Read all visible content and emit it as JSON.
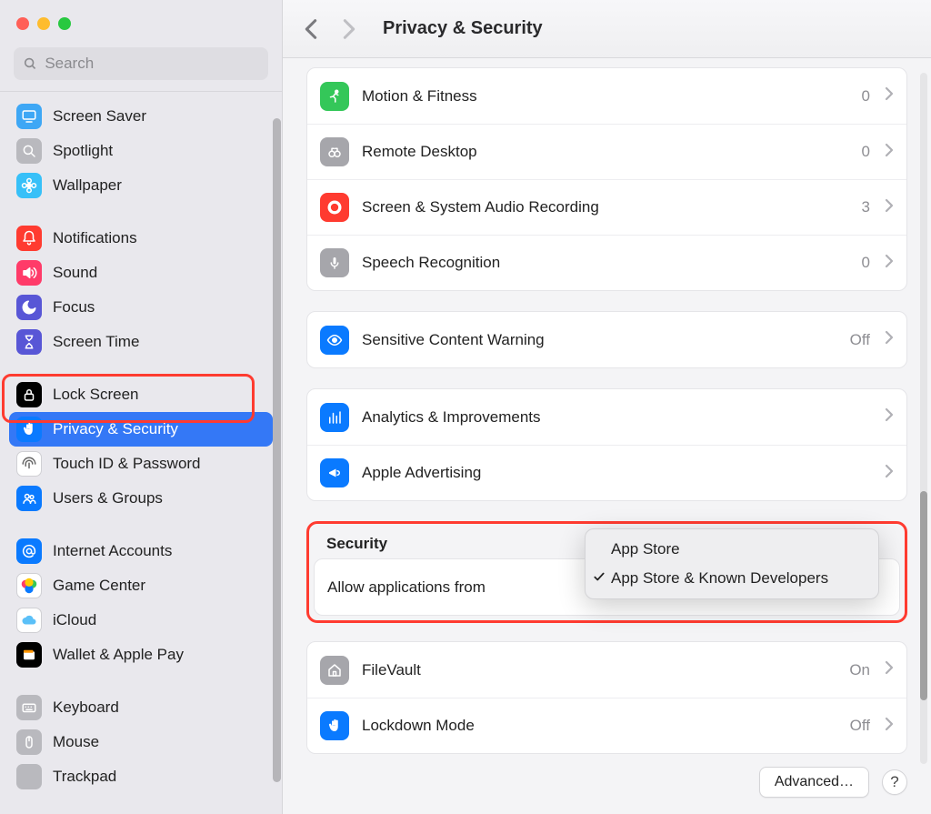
{
  "header": {
    "title": "Privacy & Security"
  },
  "search": {
    "placeholder": "Search"
  },
  "sidebar": {
    "groups": [
      {
        "items": [
          {
            "name": "screen-saver",
            "label": "Screen Saver",
            "icon_bg": "#3ea7f5",
            "icon": "monitor"
          },
          {
            "name": "spotlight",
            "label": "Spotlight",
            "icon_bg": "#b9b9be",
            "icon": "search"
          },
          {
            "name": "wallpaper",
            "label": "Wallpaper",
            "icon_bg": "#37c0f8",
            "icon": "flower"
          }
        ]
      },
      {
        "items": [
          {
            "name": "notifications",
            "label": "Notifications",
            "icon_bg": "#ff3b30",
            "icon": "bell"
          },
          {
            "name": "sound",
            "label": "Sound",
            "icon_bg": "#ff3b69",
            "icon": "speaker"
          },
          {
            "name": "focus",
            "label": "Focus",
            "icon_bg": "#5856d6",
            "icon": "moon"
          },
          {
            "name": "screen-time",
            "label": "Screen Time",
            "icon_bg": "#5856d6",
            "icon": "hourglass"
          }
        ]
      },
      {
        "items": [
          {
            "name": "lock-screen",
            "label": "Lock Screen",
            "icon_bg": "#000000",
            "icon": "lock"
          },
          {
            "name": "privacy-security",
            "label": "Privacy & Security",
            "icon_bg": "#0a7aff",
            "icon": "hand",
            "selected": true
          },
          {
            "name": "touch-id",
            "label": "Touch ID & Password",
            "icon_bg": "#ffffff",
            "icon": "fingerprint"
          },
          {
            "name": "users-groups",
            "label": "Users & Groups",
            "icon_bg": "#0a7aff",
            "icon": "users"
          }
        ]
      },
      {
        "items": [
          {
            "name": "internet-accounts",
            "label": "Internet Accounts",
            "icon_bg": "#0a7aff",
            "icon": "at"
          },
          {
            "name": "game-center",
            "label": "Game Center",
            "icon_bg": "#ffffff",
            "icon": "gamecenter"
          },
          {
            "name": "icloud",
            "label": "iCloud",
            "icon_bg": "#ffffff",
            "icon": "cloud"
          },
          {
            "name": "wallet",
            "label": "Wallet & Apple Pay",
            "icon_bg": "#000000",
            "icon": "wallet"
          }
        ]
      },
      {
        "items": [
          {
            "name": "keyboard",
            "label": "Keyboard",
            "icon_bg": "#b9b9be",
            "icon": "keyboard"
          },
          {
            "name": "mouse",
            "label": "Mouse",
            "icon_bg": "#b9b9be",
            "icon": "mouse"
          },
          {
            "name": "trackpad",
            "label": "Trackpad",
            "icon_bg": "#b9b9be",
            "icon": "trackpad"
          }
        ]
      }
    ]
  },
  "content": {
    "groups": [
      {
        "rows": [
          {
            "name": "motion-fitness",
            "label": "Motion & Fitness",
            "value": "0",
            "icon_bg": "#34c759",
            "icon": "runner"
          },
          {
            "name": "remote-desktop",
            "label": "Remote Desktop",
            "value": "0",
            "icon_bg": "#a6a6ab",
            "icon": "binoculars"
          },
          {
            "name": "screen-audio",
            "label": "Screen & System Audio Recording",
            "value": "3",
            "icon_bg": "#ff3b30",
            "icon": "record"
          },
          {
            "name": "speech",
            "label": "Speech Recognition",
            "value": "0",
            "icon_bg": "#a6a6ab",
            "icon": "mic"
          }
        ]
      },
      {
        "rows": [
          {
            "name": "sensitive-content",
            "label": "Sensitive Content Warning",
            "value": "Off",
            "icon_bg": "#0a7aff",
            "icon": "eye"
          }
        ]
      },
      {
        "rows": [
          {
            "name": "analytics",
            "label": "Analytics & Improvements",
            "value": "",
            "icon_bg": "#0a7aff",
            "icon": "chart"
          },
          {
            "name": "advertising",
            "label": "Apple Advertising",
            "value": "",
            "icon_bg": "#0a7aff",
            "icon": "megaphone"
          }
        ]
      }
    ],
    "security": {
      "title": "Security",
      "allow_label": "Allow applications from",
      "popup": {
        "options": [
          {
            "label": "App Store",
            "checked": false
          },
          {
            "label": "App Store & Known Developers",
            "checked": true
          }
        ]
      },
      "rows": [
        {
          "name": "filevault",
          "label": "FileVault",
          "value": "On",
          "icon_bg": "#a6a6ab",
          "icon": "house"
        },
        {
          "name": "lockdown",
          "label": "Lockdown Mode",
          "value": "Off",
          "icon_bg": "#0a7aff",
          "icon": "hand"
        }
      ]
    },
    "footer": {
      "advanced": "Advanced…",
      "help": "?"
    }
  }
}
